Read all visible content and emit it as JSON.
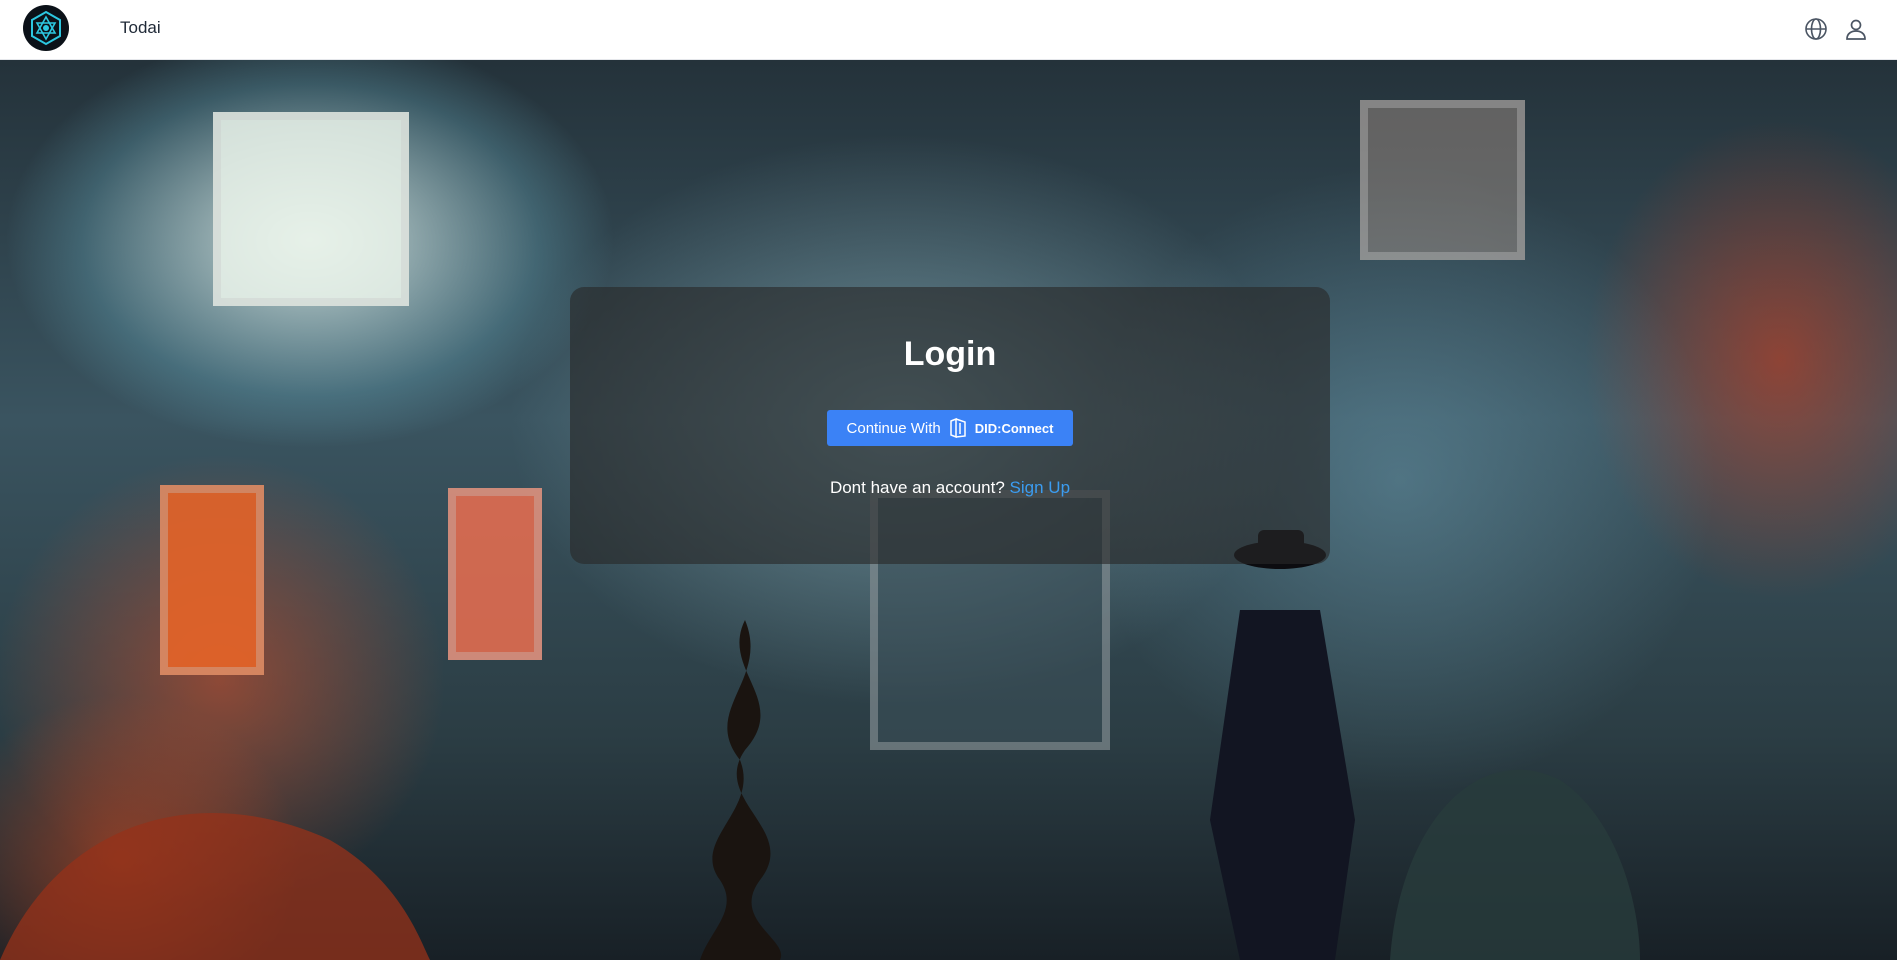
{
  "header": {
    "app_name": "Todai",
    "icons": {
      "logo": "hexagon-star-logo",
      "language": "globe-icon",
      "account": "user-icon"
    }
  },
  "login_card": {
    "title": "Login",
    "continue_button": {
      "prefix": "Continue With",
      "icon": "did-connect-icon",
      "provider": "DID:Connect",
      "color": "#3b82f6"
    },
    "signup_prompt": "Dont have an account?",
    "signup_link": "Sign Up",
    "link_color": "#3b9cf0"
  },
  "background": {
    "scene": "misty-house-night"
  }
}
